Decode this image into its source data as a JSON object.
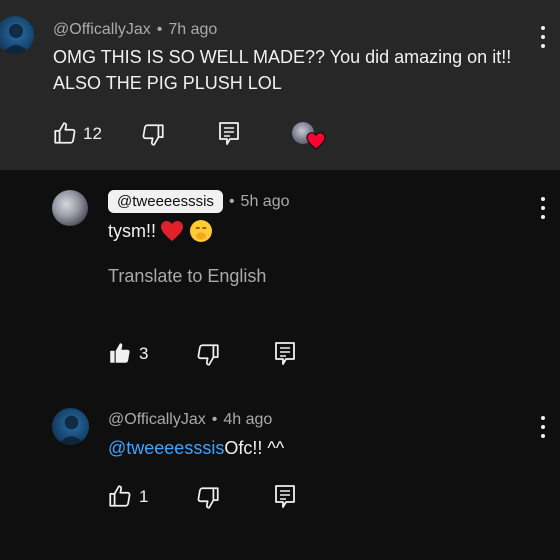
{
  "top_comment": {
    "author": "@OfficallyJax",
    "time": "7h ago",
    "text_line1": "OMG THIS IS SO WELL MADE?? You did amazing on it!!",
    "text_line2": "ALSO THE PIG PLUSH LOL",
    "likes": "12",
    "heart": "creator-heart"
  },
  "reply1": {
    "author": "@tweeeesssis",
    "time": "5h ago",
    "text": "tysm!!",
    "emojis": "❤️🤭",
    "translate": "Translate to English",
    "likes": "3"
  },
  "reply2": {
    "author": "@OfficallyJax",
    "time": "4h ago",
    "mention": "@tweeeesssis",
    "text": "Ofc!! ^^",
    "likes": "1"
  },
  "colors": {
    "bg": "#0f0f0f",
    "highlight": "#272727",
    "link": "#3ea6ff",
    "meta": "#aaaaaa"
  }
}
